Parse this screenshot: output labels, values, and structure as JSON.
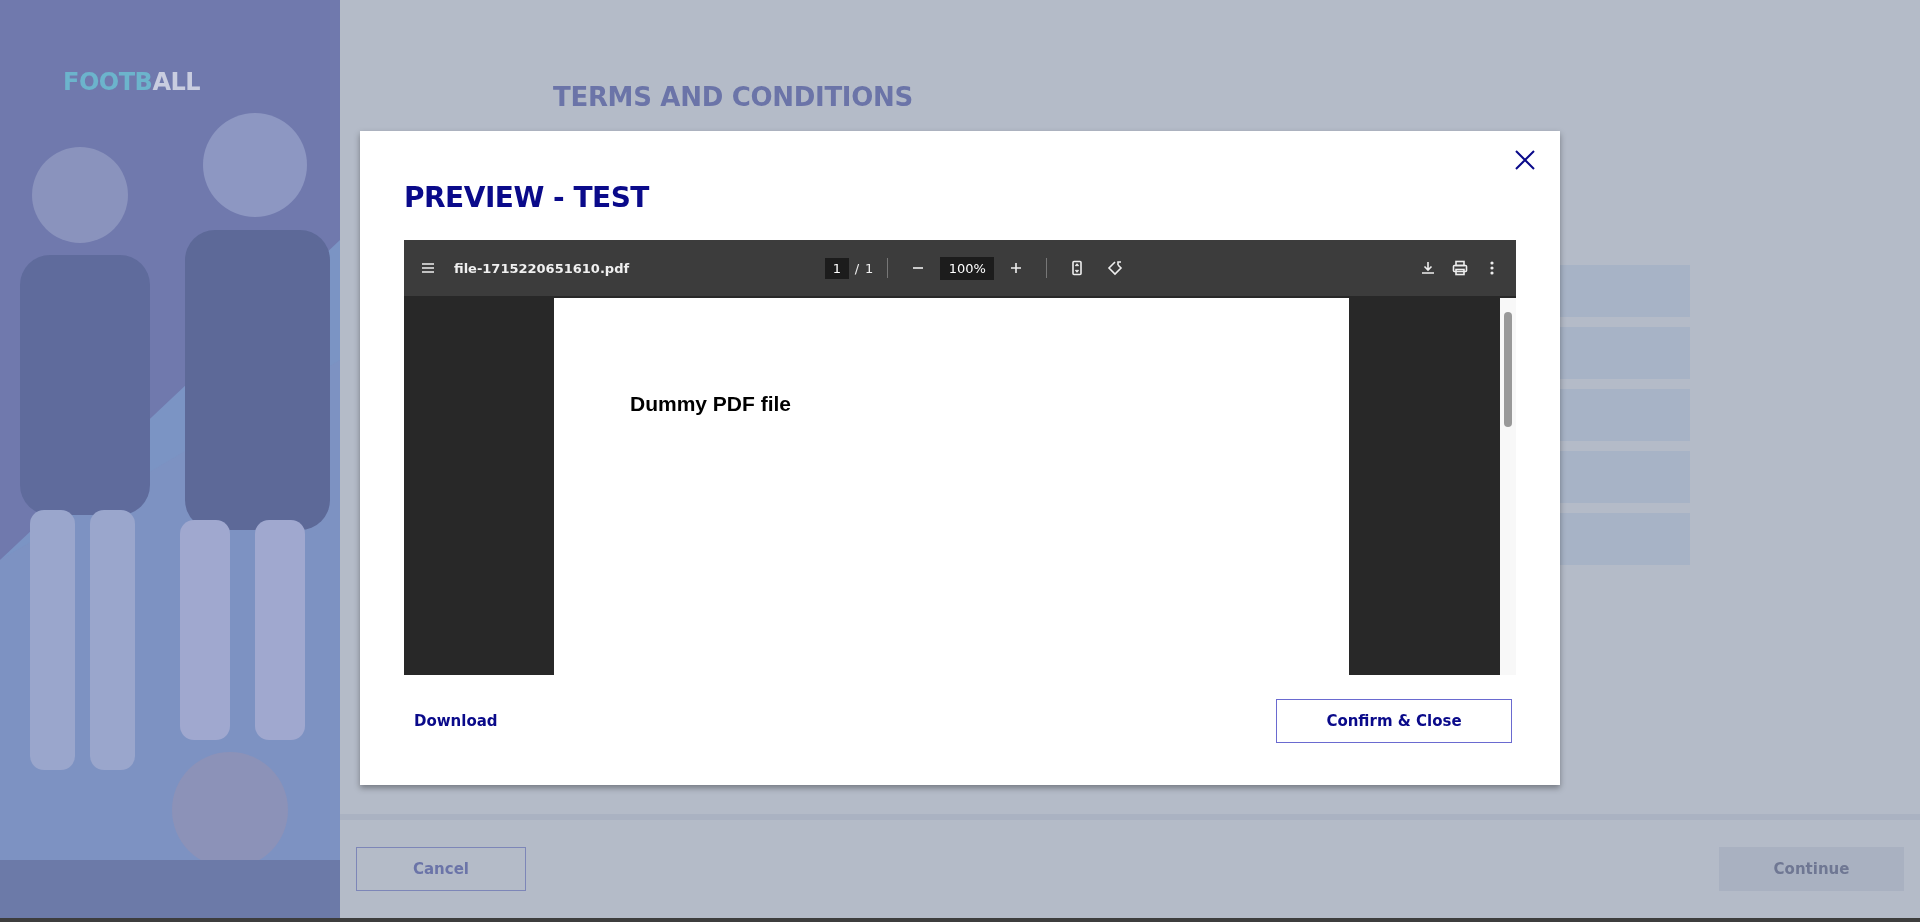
{
  "sidebar": {
    "logo": [
      {
        "text": "FOOTB",
        "color": "#6cb4cc"
      },
      {
        "text": "ALL",
        "color": "#c9cde0"
      }
    ]
  },
  "page": {
    "title": "TERMS AND CONDITIONS"
  },
  "footer": {
    "cancel": {
      "label": "Cancel"
    },
    "continue": {
      "label": "Continue",
      "disabled": true
    }
  },
  "modal": {
    "title": "PREVIEW - TEST",
    "viewer": {
      "filename": "file-1715220651610.pdf",
      "page": "1",
      "separator": "/",
      "total_pages": "1",
      "zoom": "100%",
      "document_heading": "Dummy PDF file"
    },
    "download": "Download",
    "confirm": "Confirm & Close"
  }
}
